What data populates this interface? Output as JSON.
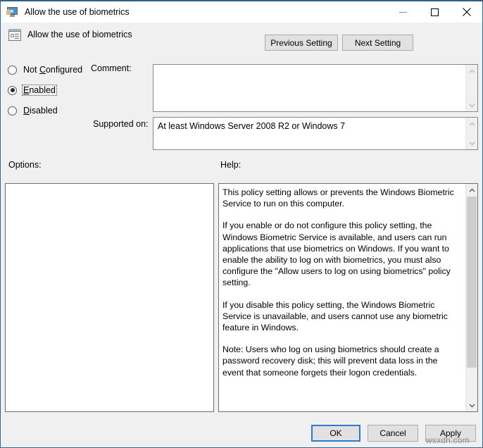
{
  "window": {
    "title": "Allow the use of biometrics",
    "icon": "computer-user-icon",
    "controls": {
      "minimize": "minimize-icon",
      "maximize": "maximize-icon",
      "close": "close-icon"
    }
  },
  "header": {
    "policy_icon": "group-policy-icon",
    "policy_title": "Allow the use of biometrics",
    "previous_setting": "Previous Setting",
    "next_setting": "Next Setting"
  },
  "state_options": [
    {
      "label": "Not Configured",
      "accel": "C",
      "before": "Not ",
      "after": "onfigured",
      "checked": false
    },
    {
      "label": "Enabled",
      "accel": "E",
      "before": "",
      "after": "nabled",
      "checked": true
    },
    {
      "label": "Disabled",
      "accel": "D",
      "before": "",
      "after": "isabled",
      "checked": false
    }
  ],
  "comment": {
    "label": "Comment:",
    "value": "",
    "placeholder": ""
  },
  "supported": {
    "label": "Supported on:",
    "value": "At least Windows Server 2008 R2 or Windows 7"
  },
  "panels": {
    "options_label": "Options:",
    "help_label": "Help:",
    "options_content": "",
    "help_paragraphs": [
      "This policy setting allows or prevents the Windows Biometric Service to run on this computer.",
      "If you enable or do not configure this policy setting, the Windows Biometric Service is available, and users can run applications that use biometrics on Windows. If you want to enable the ability to log on with biometrics, you must also configure the \"Allow users to log on using biometrics\" policy setting.",
      "If you disable this policy setting, the Windows Biometric Service is unavailable, and users cannot use any biometric feature in Windows.",
      "Note: Users who log on using biometrics should create a password recovery disk; this will prevent data loss in the event that someone forgets their logon credentials."
    ]
  },
  "footer": {
    "ok": "OK",
    "cancel": "Cancel",
    "apply": "Apply"
  },
  "watermark": "wsxdn.com",
  "colors": {
    "window_border": "#2b6a97",
    "default_button_border": "#2b7cc4",
    "dialog_background": "#f0f0f0",
    "field_background": "#ffffff",
    "scrollbar_thumb": "#cdcdcd"
  }
}
